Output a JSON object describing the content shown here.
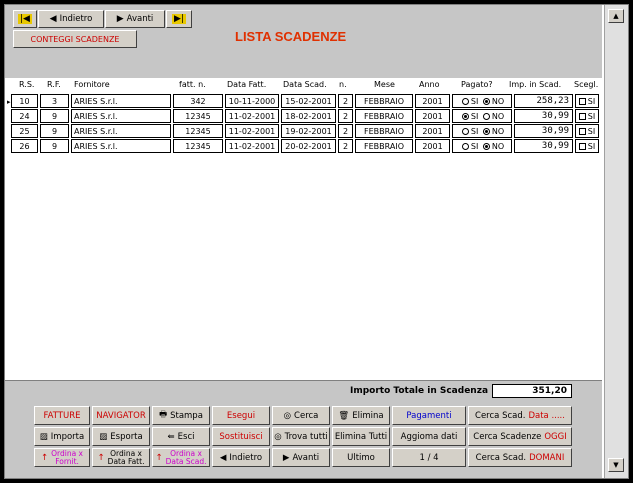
{
  "nav": {
    "back_label": "Indietro",
    "forward_label": "Avanti"
  },
  "conteggi_label": "CONTEGGI SCADENZE",
  "title": "LISTA SCADENZE",
  "headers": [
    "R.S.",
    "R.F.",
    "Fornitore",
    "fatt. n.",
    "Data Fatt.",
    "Data Scad.",
    "n.",
    "Mese",
    "Anno",
    "Pagato?",
    "Imp. in Scad.",
    "Scegl."
  ],
  "rows": [
    {
      "rs": "10",
      "rf": "3",
      "fornitore": "ARIES S.r.l.",
      "fatt": "342",
      "data_fatt": "10-11-2000",
      "data_scad": "15-02-2001",
      "n": "2",
      "mese": "FEBBRAIO",
      "anno": "2001",
      "si_label": "SI",
      "no_label": "NO",
      "pagato": "no",
      "imp": "258,23",
      "sel_label": "SI"
    },
    {
      "rs": "24",
      "rf": "9",
      "fornitore": "ARIES S.r.l.",
      "fatt": "12345",
      "data_fatt": "11-02-2001",
      "data_scad": "18-02-2001",
      "n": "2",
      "mese": "FEBBRAIO",
      "anno": "2001",
      "si_label": "SI",
      "no_label": "NO",
      "pagato": "si",
      "imp": "30,99",
      "sel_label": "SI"
    },
    {
      "rs": "25",
      "rf": "9",
      "fornitore": "ARIES S.r.l.",
      "fatt": "12345",
      "data_fatt": "11-02-2001",
      "data_scad": "19-02-2001",
      "n": "2",
      "mese": "FEBBRAIO",
      "anno": "2001",
      "si_label": "SI",
      "no_label": "NO",
      "pagato": "no",
      "imp": "30,99",
      "sel_label": "SI"
    },
    {
      "rs": "26",
      "rf": "9",
      "fornitore": "ARIES S.r.l.",
      "fatt": "12345",
      "data_fatt": "11-02-2001",
      "data_scad": "20-02-2001",
      "n": "2",
      "mese": "FEBBRAIO",
      "anno": "2001",
      "si_label": "SI",
      "no_label": "NO",
      "pagato": "no",
      "imp": "30,99",
      "sel_label": "SI"
    }
  ],
  "total": {
    "label": "Importo Totale in Scadenza",
    "value": "351,20"
  },
  "buttons": {
    "fatture": "FATTURE",
    "navigator": "NAVIGATOR",
    "stampa": "Stampa",
    "esegui": "Esegui",
    "cerca": "Cerca",
    "elimina": "Elimina",
    "pagamenti": "Pagamenti",
    "cerca_data_1": "Cerca Scad. ",
    "cerca_data_2": "Data .....",
    "importa": "Importa",
    "esporta": "Esporta",
    "esci": "Esci",
    "sostituisci": "Sostituisci",
    "trova_tutti": "Trova tutti",
    "elimina_tutti": "Elimina Tutti",
    "aggiorna": "Aggioma dati",
    "cerca_oggi_1": "Cerca Scadenze ",
    "cerca_oggi_2": "OGGI",
    "ord_fornit_1": "Ordina x",
    "ord_fornit_2": "Fornit.",
    "ord_fatt_1": "Ordina x",
    "ord_fatt_2": "Data Fatt.",
    "ord_scad_1": "Ordina x",
    "ord_scad_2": "Data Scad.",
    "indietro": "Indietro",
    "avanti": "Avanti",
    "ultimo": "Ultimo",
    "record_counter": "1 / 4",
    "cerca_domani_1": "Cerca Scad. ",
    "cerca_domani_2": "DOMANI"
  },
  "colors": {
    "title": "#e03000",
    "accent_red": "#cc0000",
    "panel": "#c6c6c6"
  }
}
